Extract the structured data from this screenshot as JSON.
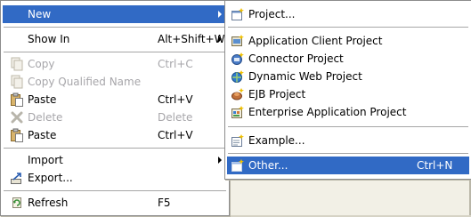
{
  "context_menu": {
    "items": [
      {
        "label": "New",
        "has_submenu": true
      },
      {
        "label": "Show In",
        "shortcut": "Alt+Shift+W",
        "has_submenu": true
      },
      {
        "label": "Copy",
        "shortcut": "Ctrl+C",
        "icon": "copy-icon",
        "enabled": false
      },
      {
        "label": "Copy Qualified Name",
        "icon": "copy-icon",
        "enabled": false
      },
      {
        "label": "Paste",
        "shortcut": "Ctrl+V",
        "icon": "paste-icon"
      },
      {
        "label": "Delete",
        "shortcut": "Delete",
        "icon": "delete-icon",
        "enabled": false
      },
      {
        "label": "Paste",
        "shortcut": "Ctrl+V",
        "icon": "paste-icon"
      },
      {
        "label": "Import",
        "has_submenu": true
      },
      {
        "label": "Export...",
        "icon": "export-icon"
      },
      {
        "label": "Refresh",
        "shortcut": "F5",
        "icon": "refresh-icon"
      }
    ]
  },
  "new_submenu": {
    "items": [
      {
        "label": "Project...",
        "icon": "new-project-icon"
      },
      {
        "label": "Application Client Project",
        "icon": "app-client-project-icon"
      },
      {
        "label": "Connector Project",
        "icon": "connector-project-icon"
      },
      {
        "label": "Dynamic Web Project",
        "icon": "web-project-icon"
      },
      {
        "label": "EJB Project",
        "icon": "ejb-project-icon"
      },
      {
        "label": "Enterprise Application Project",
        "icon": "enterprise-app-project-icon"
      },
      {
        "label": "Example...",
        "icon": "example-icon"
      },
      {
        "label": "Other...",
        "shortcut": "Ctrl+N",
        "icon": "other-wizard-icon",
        "selected": true
      }
    ]
  },
  "colors": {
    "selection": "#316ac5",
    "menu_background": "#ffffff",
    "disabled_text": "#a7a6aa"
  }
}
